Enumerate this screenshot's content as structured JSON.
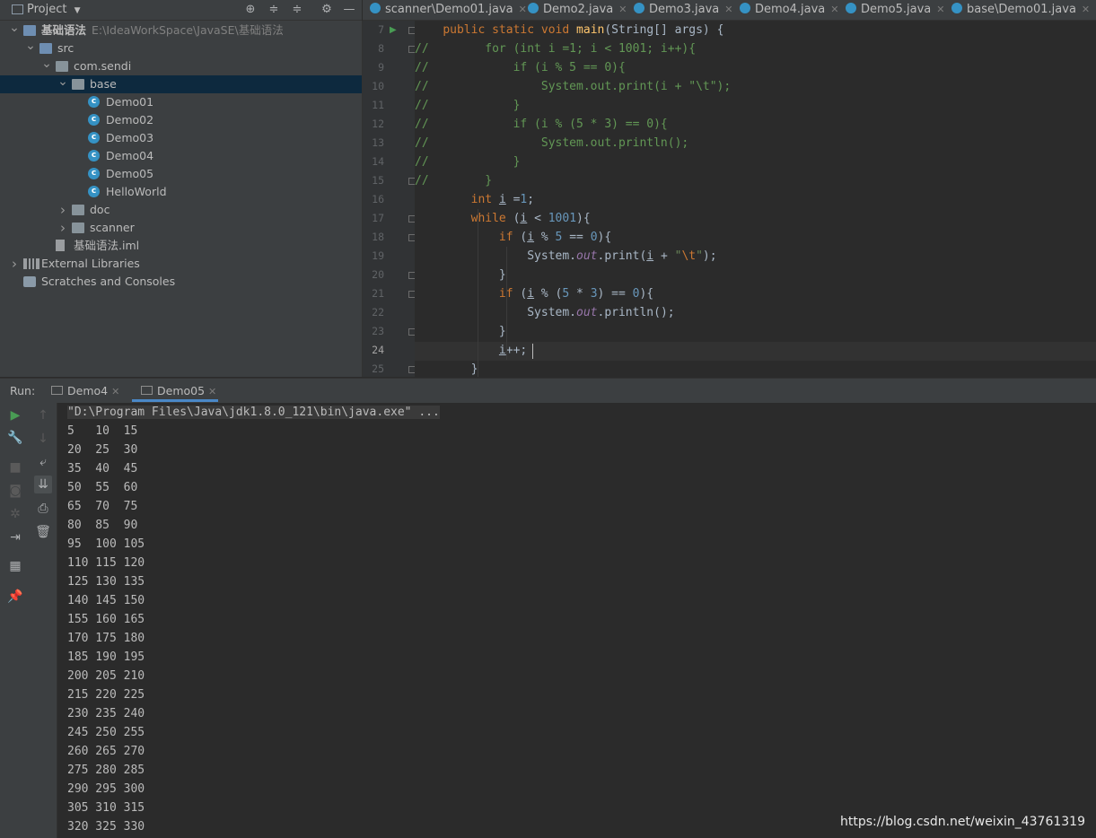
{
  "project_panel": {
    "title": "Project",
    "tree": [
      {
        "label": "基础语法",
        "path": "E:\\IdeaWorkSpace\\JavaSE\\基础语法",
        "depth": 0,
        "arrow": "open",
        "icon": "folder-icon",
        "bold": true
      },
      {
        "label": "src",
        "depth": 1,
        "arrow": "open",
        "icon": "folder-icon"
      },
      {
        "label": "com.sendi",
        "depth": 2,
        "arrow": "open",
        "icon": "package-icon"
      },
      {
        "label": "base",
        "depth": 3,
        "arrow": "open",
        "icon": "package-icon",
        "selected": true
      },
      {
        "label": "Demo01",
        "depth": 4,
        "arrow": "none",
        "icon": "java-class-icon"
      },
      {
        "label": "Demo02",
        "depth": 4,
        "arrow": "none",
        "icon": "java-class-icon"
      },
      {
        "label": "Demo03",
        "depth": 4,
        "arrow": "none",
        "icon": "java-class-icon"
      },
      {
        "label": "Demo04",
        "depth": 4,
        "arrow": "none",
        "icon": "java-class-icon"
      },
      {
        "label": "Demo05",
        "depth": 4,
        "arrow": "none",
        "icon": "java-class-icon"
      },
      {
        "label": "HelloWorld",
        "depth": 4,
        "arrow": "none",
        "icon": "java-class-icon"
      },
      {
        "label": "doc",
        "depth": 3,
        "arrow": "closed",
        "icon": "package-icon"
      },
      {
        "label": "scanner",
        "depth": 3,
        "arrow": "closed",
        "icon": "package-icon"
      },
      {
        "label": "基础语法.iml",
        "depth": 2,
        "arrow": "none",
        "icon": "iml-file-icon"
      },
      {
        "label": "External Libraries",
        "depth": 0,
        "arrow": "closed",
        "icon": "library-icon"
      },
      {
        "label": "Scratches and Consoles",
        "depth": 0,
        "arrow": "none",
        "icon": "scratches-icon"
      }
    ]
  },
  "editor_tabs": [
    "scanner\\Demo01.java",
    "Demo2.java",
    "Demo3.java",
    "Demo4.java",
    "Demo5.java",
    "base\\Demo01.java"
  ],
  "editor": {
    "current_line": 24,
    "lines": [
      {
        "n": 7,
        "text": "    public static void main(String[] args) {"
      },
      {
        "n": 8,
        "text": "//        for (int i =1; i < 1001; i++){"
      },
      {
        "n": 9,
        "text": "//            if (i % 5 == 0){"
      },
      {
        "n": 10,
        "text": "//                System.out.print(i + \"\\t\");"
      },
      {
        "n": 11,
        "text": "//            }"
      },
      {
        "n": 12,
        "text": "//            if (i % (5 * 3) == 0){"
      },
      {
        "n": 13,
        "text": "//                System.out.println();"
      },
      {
        "n": 14,
        "text": "//            }"
      },
      {
        "n": 15,
        "text": "//        }"
      },
      {
        "n": 16,
        "text": "        int i =1;"
      },
      {
        "n": 17,
        "text": "        while (i < 1001){"
      },
      {
        "n": 18,
        "text": "            if (i % 5 == 0){"
      },
      {
        "n": 19,
        "text": "                System.out.print(i + \"\\t\");"
      },
      {
        "n": 20,
        "text": "            }"
      },
      {
        "n": 21,
        "text": "            if (i % (5 * 3) == 0){"
      },
      {
        "n": 22,
        "text": "                System.out.println();"
      },
      {
        "n": 23,
        "text": "            }"
      },
      {
        "n": 24,
        "text": "            i++;"
      },
      {
        "n": 25,
        "text": "        }"
      }
    ]
  },
  "run_panel": {
    "label": "Run:",
    "tabs": [
      "Demo4",
      "Demo05"
    ],
    "command": "\"D:\\Program Files\\Java\\jdk1.8.0_121\\bin\\java.exe\" ...",
    "output": [
      "5   10  15",
      "20  25  30",
      "35  40  45",
      "50  55  60",
      "65  70  75",
      "80  85  90",
      "95  100 105",
      "110 115 120",
      "125 130 135",
      "140 145 150",
      "155 160 165",
      "170 175 180",
      "185 190 195",
      "200 205 210",
      "215 220 225",
      "230 235 240",
      "245 250 255",
      "260 265 270",
      "275 280 285",
      "290 295 300",
      "305 310 315",
      "320 325 330"
    ]
  },
  "watermark": "https://blog.csdn.net/weixin_43761319",
  "colors": {
    "keyword": "#cc7832",
    "comment": "#629755",
    "number": "#6897bb",
    "string": "#6a8759",
    "function": "#ffc66d",
    "static_field": "#9876aa"
  }
}
